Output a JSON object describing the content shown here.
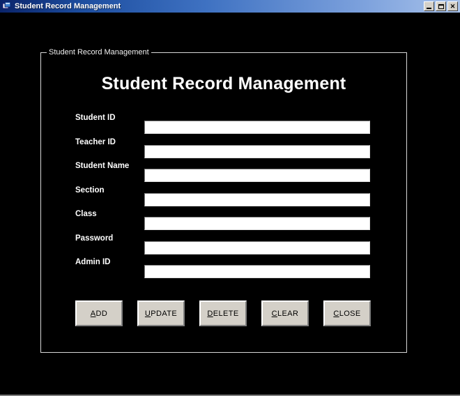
{
  "window": {
    "title": "Student Record Management",
    "icon": "app-window-icon",
    "controls": {
      "minimize": "minimize-icon",
      "maximize": "maximize-icon",
      "close": "✕"
    },
    "background_color": "#000000",
    "titlebar_gradient_start": "#0a246a",
    "titlebar_gradient_end": "#a8c2ea"
  },
  "groupbox": {
    "legend": "Student Record Management",
    "border_color": "#d8d8d8"
  },
  "heading": {
    "text": "Student Record Management",
    "color": "#ffffff"
  },
  "form": {
    "fields": [
      {
        "label": "Student ID",
        "value": "",
        "placeholder": ""
      },
      {
        "label": "Teacher ID",
        "value": "",
        "placeholder": ""
      },
      {
        "label": "Student Name",
        "value": "",
        "placeholder": ""
      },
      {
        "label": "Section",
        "value": "",
        "placeholder": ""
      },
      {
        "label": "Class",
        "value": "",
        "placeholder": ""
      },
      {
        "label": "Password",
        "value": "",
        "placeholder": ""
      },
      {
        "label": "Admin ID",
        "value": "",
        "placeholder": ""
      }
    ]
  },
  "buttons": [
    {
      "mnemonic": "A",
      "rest": "DD",
      "full": "ADD"
    },
    {
      "mnemonic": "U",
      "rest": "PDATE",
      "full": "UPDATE"
    },
    {
      "mnemonic": "D",
      "rest": "ELETE",
      "full": "DELETE"
    },
    {
      "mnemonic": "C",
      "rest": "LEAR",
      "full": "CLEAR"
    },
    {
      "mnemonic": "C",
      "rest": "LOSE",
      "full": "CLOSE"
    }
  ],
  "colors": {
    "button_face": "#d4d0c8",
    "input_background": "#ffffff",
    "text_on_black": "#ffffff"
  }
}
